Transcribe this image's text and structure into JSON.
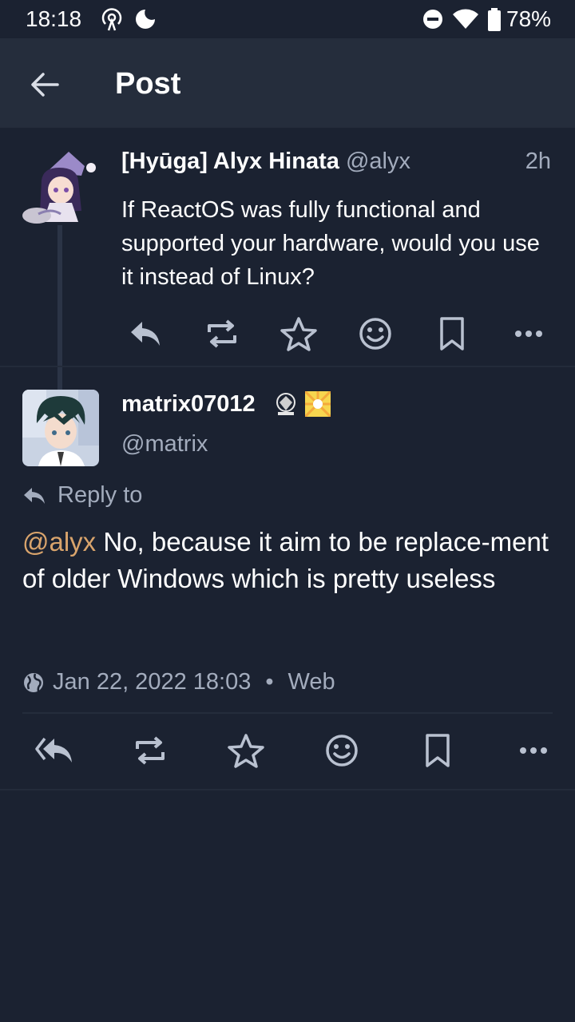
{
  "status_bar": {
    "time": "18:18",
    "battery_percent": "78%",
    "icons": [
      "hotspot-icon",
      "moon-icon",
      "dnd-icon",
      "wifi-icon",
      "battery-icon"
    ]
  },
  "app_bar": {
    "title": "Post"
  },
  "parent_post": {
    "display_name": "[Hyūga] Alyx Hinata",
    "handle": "@alyx",
    "time": "2h",
    "text": "If ReactOS was fully functional and supported your hardware, would you use it instead of Linux?"
  },
  "reply_post": {
    "display_name": "matrix07012",
    "handle": "@matrix",
    "reply_to_label": "Reply to",
    "mention": "@alyx",
    "text": " No, because it aim to be replace-ment of older Windows which is pretty useless",
    "date": "Jan 22, 2022 18:03",
    "separator": "•",
    "source": "Web"
  },
  "colors": {
    "background": "#1b2231",
    "app_bar": "#252d3c",
    "secondary_text": "#a3acbd",
    "mention": "#d9a46c"
  }
}
